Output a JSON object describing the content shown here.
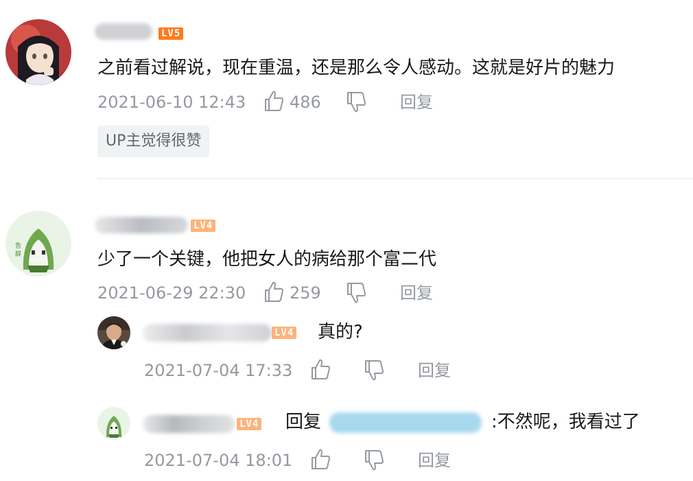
{
  "comments": [
    {
      "level": "LV5",
      "text": "之前看过解说，现在重温，还是那么令人感动。这就是好片的魅力",
      "time": "2021-06-10 12:43",
      "likes": "486",
      "reply_label": "回复",
      "badge": "UP主觉得很赞"
    },
    {
      "level": "LV4",
      "text": "少了一个关键，他把女人的病给那个富二代",
      "time": "2021-06-29 22:30",
      "likes": "259",
      "reply_label": "回复",
      "replies": [
        {
          "level": "LV4",
          "text": "真的?",
          "time": "2021-07-04 17:33",
          "reply_label": "回复"
        },
        {
          "level": "LV4",
          "reply_prefix": "回复",
          "text": ":不然呢，我看过了",
          "time": "2021-07-04 18:01",
          "reply_label": "回复"
        }
      ]
    }
  ],
  "icons": {
    "like": "thumbs-up-icon",
    "dislike": "thumbs-down-icon"
  },
  "colors": {
    "level5": "#ff7a1a",
    "level4": "#ffb27a",
    "meta_text": "#9499a0",
    "badge_bg": "#f1f2f3"
  }
}
